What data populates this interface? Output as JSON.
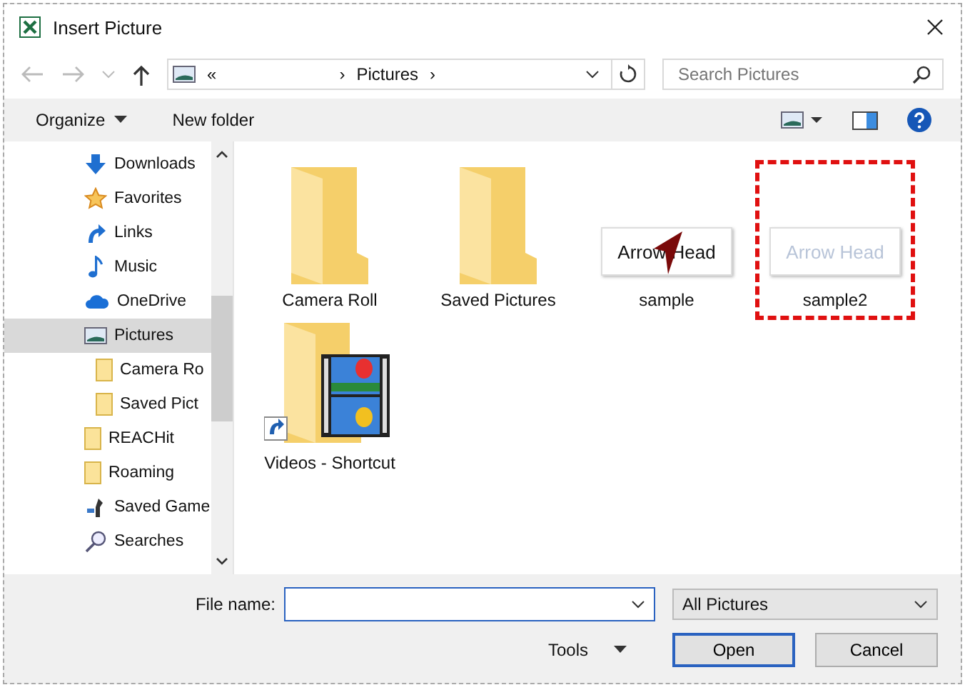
{
  "window": {
    "title": "Insert Picture"
  },
  "address": {
    "prefix": "«",
    "location": "Pictures",
    "separator": "›"
  },
  "search": {
    "placeholder": "Search Pictures"
  },
  "toolbar": {
    "organize": "Organize",
    "new_folder": "New folder"
  },
  "sidebar": {
    "items": [
      {
        "label": "Downloads",
        "kind": "downloads",
        "selected": false
      },
      {
        "label": "Favorites",
        "kind": "favorites",
        "selected": false
      },
      {
        "label": "Links",
        "kind": "links",
        "selected": false
      },
      {
        "label": "Music",
        "kind": "music",
        "selected": false
      },
      {
        "label": "OneDrive",
        "kind": "cloud",
        "selected": false
      },
      {
        "label": "Pictures",
        "kind": "pictures",
        "selected": true,
        "children": [
          {
            "label": "Camera Ro",
            "kind": "folder",
            "selected": false
          },
          {
            "label": "Saved Pict",
            "kind": "folder",
            "selected": false
          }
        ]
      },
      {
        "label": "REACHit",
        "kind": "folder",
        "selected": false
      },
      {
        "label": "Roaming",
        "kind": "folder",
        "selected": false
      },
      {
        "label": "Saved Game",
        "kind": "games",
        "selected": false
      },
      {
        "label": "Searches",
        "kind": "search",
        "selected": false
      }
    ]
  },
  "files": [
    {
      "name": "Camera Roll",
      "kind": "folder",
      "selected": false
    },
    {
      "name": "Saved Pictures",
      "kind": "folder",
      "selected": false
    },
    {
      "name": "sample",
      "kind": "image",
      "image_text": "Arrow Head",
      "faded": false,
      "selected": false
    },
    {
      "name": "sample2",
      "kind": "image",
      "image_text": "Arrow Head",
      "faded": true,
      "selected": true
    },
    {
      "name": "Videos - Shortcut",
      "kind": "shortcut",
      "selected": false
    }
  ],
  "footer": {
    "file_name_label": "File name:",
    "file_type": "All Pictures",
    "tools": "Tools",
    "open": "Open",
    "cancel": "Cancel"
  }
}
